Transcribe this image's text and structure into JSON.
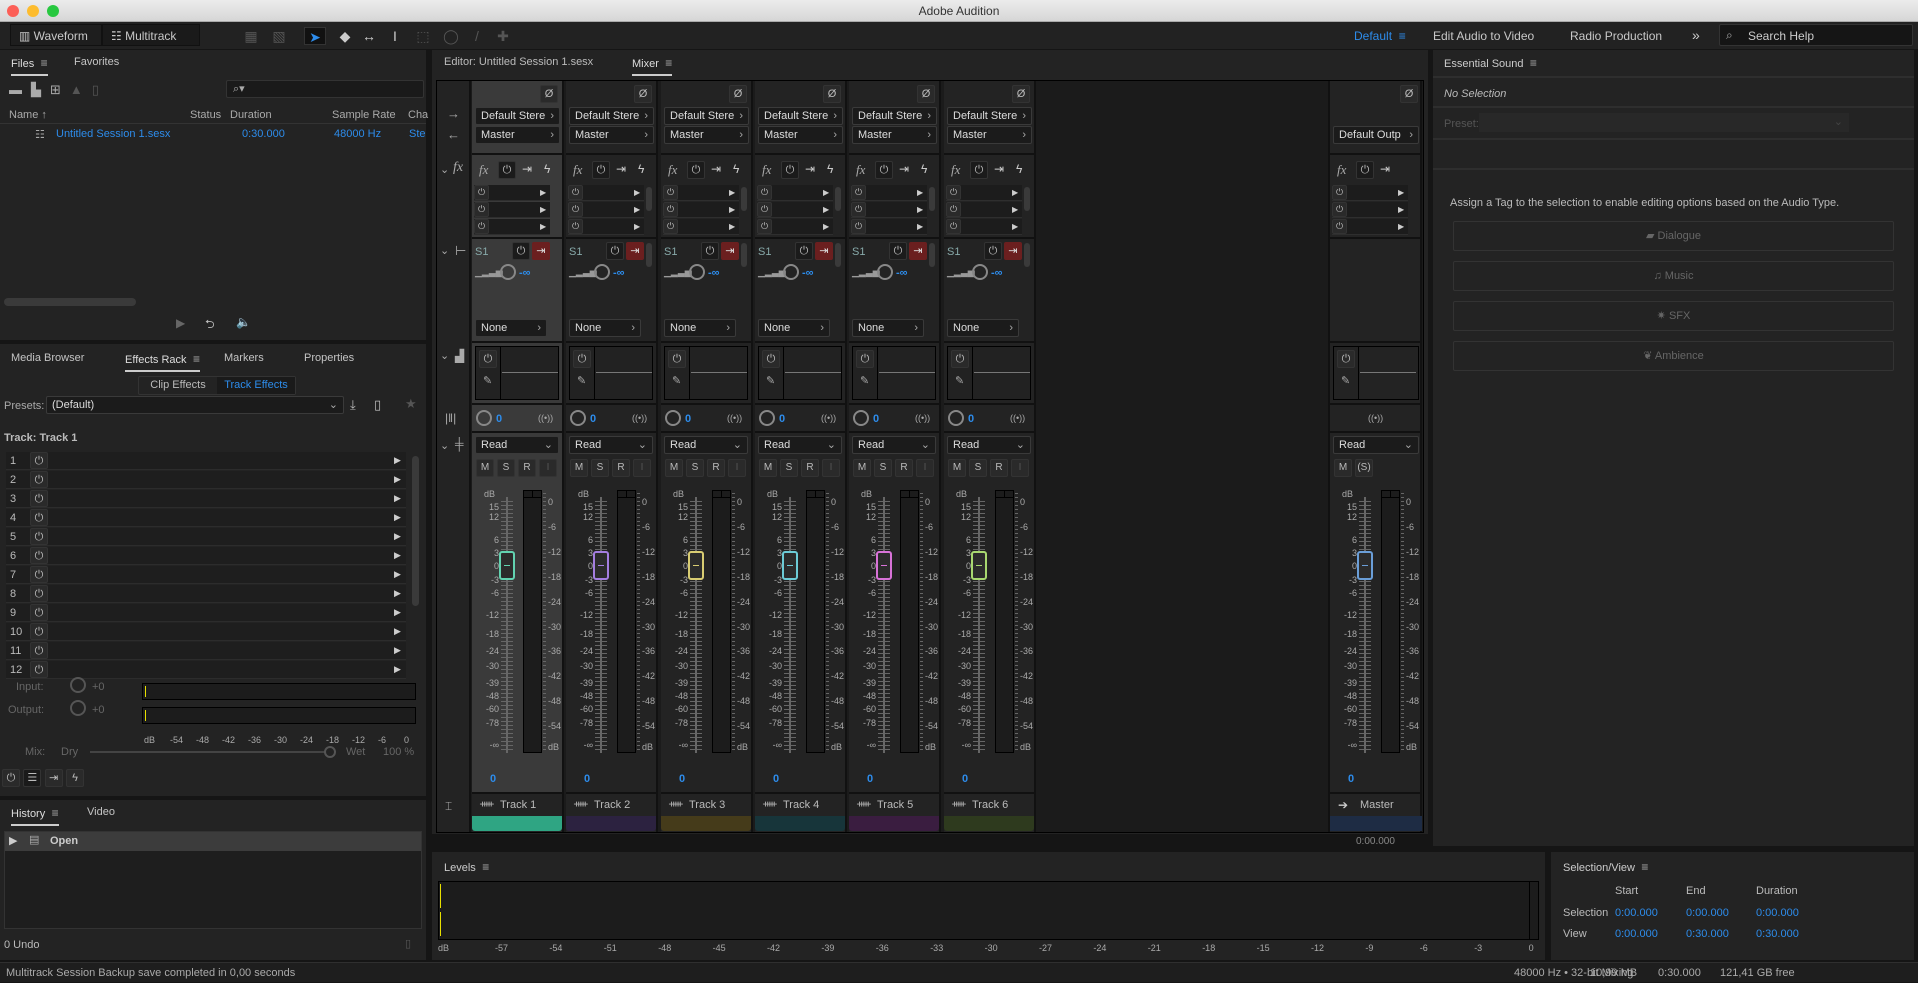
{
  "window": {
    "title": "Adobe Audition"
  },
  "toolbar": {
    "waveform": "Waveform",
    "multitrack": "Multitrack",
    "workspaces": [
      {
        "label": "Default",
        "active": true
      },
      {
        "label": "Edit Audio to Video"
      },
      {
        "label": "Radio Production"
      }
    ],
    "more": "»",
    "search_placeholder": "Search Help"
  },
  "files": {
    "tabs": [
      "Files",
      "Favorites"
    ],
    "columns": [
      "Name",
      "Status",
      "Duration",
      "Sample Rate",
      "Cha"
    ],
    "rows": [
      {
        "name": "Untitled Session 1.sesx",
        "status": "",
        "duration": "0:30.000",
        "sample_rate": "48000 Hz",
        "channels": "Ste"
      }
    ]
  },
  "effects": {
    "tabs": [
      "Media Browser",
      "Effects Rack",
      "Markers",
      "Properties"
    ],
    "subtabs": [
      "Clip Effects",
      "Track Effects"
    ],
    "presets_label": "Presets:",
    "preset": "(Default)",
    "track_label": "Track: Track 1",
    "slots": [
      "1",
      "2",
      "3",
      "4",
      "5",
      "6",
      "7",
      "8",
      "9",
      "10",
      "11",
      "12"
    ],
    "input_label": "Input:",
    "input_value": "+0",
    "output_label": "Output:",
    "output_value": "+0",
    "scale": [
      "dB",
      "-54",
      "-48",
      "-42",
      "-36",
      "-30",
      "-24",
      "-18",
      "-12",
      "-6",
      "0"
    ],
    "mix_label": "Mix:",
    "dry": "Dry",
    "wet": "Wet",
    "mix_value": "100 %",
    "mix_fraction": 1.0
  },
  "history": {
    "tabs": [
      "History",
      "Video"
    ],
    "items": [
      "Open"
    ],
    "undo": "0 Undo"
  },
  "editor": {
    "tab": "Editor: Untitled Session 1.sesx",
    "mixer_tab": "Mixer"
  },
  "mixer": {
    "fader_scale": [
      "15",
      "12",
      "6",
      "3",
      "0",
      "-3",
      "-6",
      "-12",
      "-18",
      "-24",
      "-30",
      "-39",
      "-48",
      "-60",
      "-78",
      "-∞"
    ],
    "meter_scale": [
      "0",
      "-6",
      "-12",
      "-18",
      "-24",
      "-30",
      "-36",
      "-42",
      "-48",
      "-54",
      "dB"
    ],
    "db_label": "dB",
    "tracks": [
      {
        "name": "Track 1",
        "input": "Default Stere",
        "output": "Master",
        "send": "S1",
        "send_value": "-∞",
        "send_dest": "None",
        "pan": "0",
        "automation": "Read",
        "volume": "0",
        "m": "M",
        "s": "S",
        "r": "R",
        "i": "I",
        "color": "#2fa583",
        "fader_color": "#62d2b0",
        "selected": true
      },
      {
        "name": "Track 2",
        "input": "Default Stere",
        "output": "Master",
        "send": "S1",
        "send_value": "-∞",
        "send_dest": "None",
        "pan": "0",
        "automation": "Read",
        "volume": "0",
        "m": "M",
        "s": "S",
        "r": "R",
        "i": "I",
        "color": "#2c2240",
        "fader_color": "#a47ee0"
      },
      {
        "name": "Track 3",
        "input": "Default Stere",
        "output": "Master",
        "send": "S1",
        "send_value": "-∞",
        "send_dest": "None",
        "pan": "0",
        "automation": "Read",
        "volume": "0",
        "m": "M",
        "s": "S",
        "r": "R",
        "i": "I",
        "color": "#453b1a",
        "fader_color": "#d8cc72"
      },
      {
        "name": "Track 4",
        "input": "Default Stere",
        "output": "Master",
        "send": "S1",
        "send_value": "-∞",
        "send_dest": "None",
        "pan": "0",
        "automation": "Read",
        "volume": "0",
        "m": "M",
        "s": "S",
        "r": "R",
        "i": "I",
        "color": "#17353a",
        "fader_color": "#6ccbd6"
      },
      {
        "name": "Track 5",
        "input": "Default Stere",
        "output": "Master",
        "send": "S1",
        "send_value": "-∞",
        "send_dest": "None",
        "pan": "0",
        "automation": "Read",
        "volume": "0",
        "m": "M",
        "s": "S",
        "r": "R",
        "i": "I",
        "color": "#3a1d40",
        "fader_color": "#d872d8"
      },
      {
        "name": "Track 6",
        "input": "Default Stere",
        "output": "Master",
        "send": "S1",
        "send_value": "-∞",
        "send_dest": "None",
        "pan": "0",
        "automation": "Read",
        "volume": "0",
        "m": "M",
        "s": "S",
        "r": "R",
        "i": "I",
        "color": "#2e3a1e",
        "fader_color": "#a8d870"
      }
    ],
    "master": {
      "name": "Master",
      "output": "Default Outp",
      "automation": "Read",
      "volume": "0",
      "m": "M",
      "s": "(S)",
      "color": "#1e2c44",
      "fader_color": "#6a9ed8",
      "time": "0:00.000"
    }
  },
  "levels": {
    "title": "Levels",
    "scale": [
      "dB",
      "-57",
      "-54",
      "-51",
      "-48",
      "-45",
      "-42",
      "-39",
      "-36",
      "-33",
      "-30",
      "-27",
      "-24",
      "-21",
      "-18",
      "-15",
      "-12",
      "-9",
      "-6",
      "-3",
      "0"
    ]
  },
  "selection_view": {
    "title": "Selection/View",
    "columns": [
      "Start",
      "End",
      "Duration"
    ],
    "rows": [
      {
        "label": "Selection",
        "start": "0:00.000",
        "end": "0:00.000",
        "duration": "0:00.000"
      },
      {
        "label": "View",
        "start": "0:00.000",
        "end": "0:30.000",
        "duration": "0:30.000"
      }
    ]
  },
  "essential_sound": {
    "title": "Essential Sound",
    "selection": "No Selection",
    "preset_label": "Preset:",
    "message": "Assign a Tag to the selection to enable editing options based on the Audio Type.",
    "types": [
      "Dialogue",
      "Music",
      "SFX",
      "Ambience"
    ]
  },
  "status": {
    "message": "Multitrack Session Backup save completed in 0,00 seconds",
    "format": "48000 Hz • 32-bit Mixing",
    "size": "10,99 MB",
    "duration": "0:30.000",
    "free": "121,41 GB free"
  },
  "colors": {
    "accent": "#2d8ceb",
    "send_active": "#6b1f1f",
    "input_level": "#e8e000"
  }
}
